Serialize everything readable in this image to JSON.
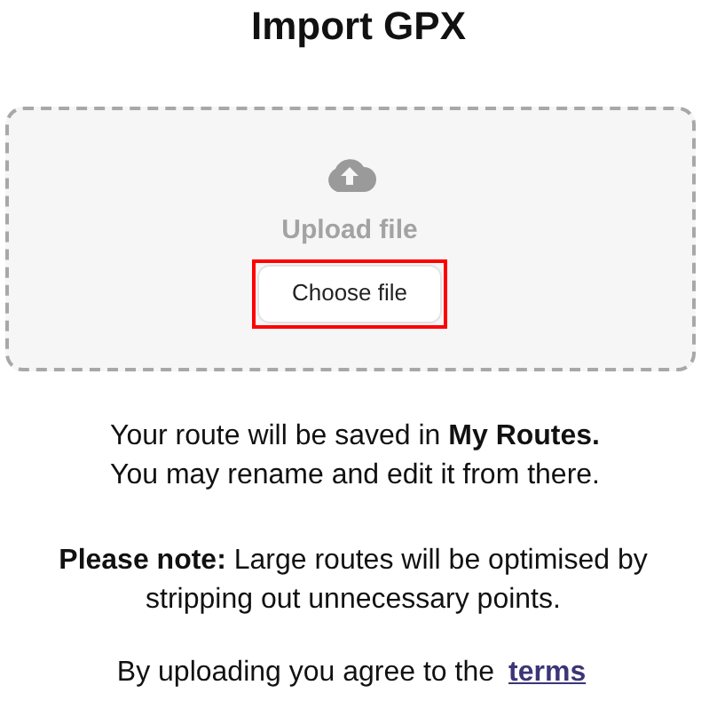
{
  "title": "Import GPX",
  "upload": {
    "label": "Upload file",
    "button": {
      "label": "Choose file",
      "highlighted": true
    }
  },
  "info": [
    "Your route will be saved in **My Routes.**",
    "You may rename and edit it from there."
  ],
  "note": "**Please note:** Large routes will be optimised by stripping out unnecessary points.",
  "terms": {
    "text": "By uploading you agree to the",
    "link": "terms"
  }
}
